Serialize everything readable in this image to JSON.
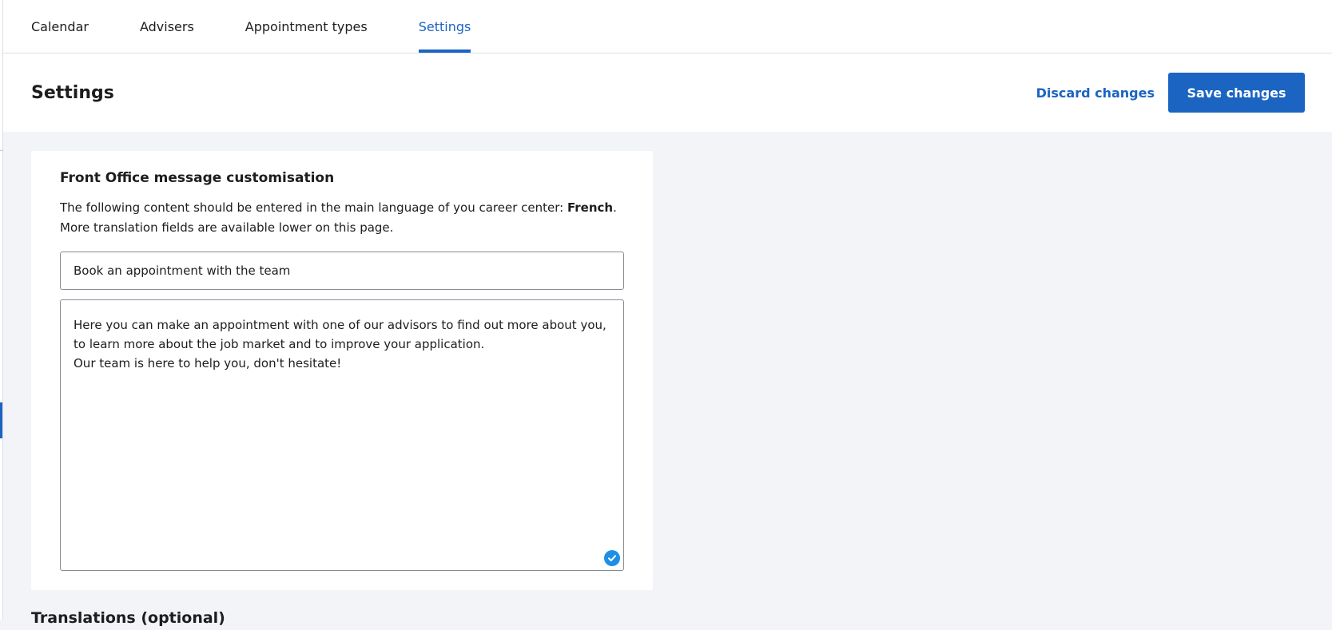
{
  "tabs": [
    {
      "label": "Calendar",
      "active": false
    },
    {
      "label": "Advisers",
      "active": false
    },
    {
      "label": "Appointment types",
      "active": false
    },
    {
      "label": "Settings",
      "active": true
    }
  ],
  "header": {
    "title": "Settings",
    "discard_label": "Discard changes",
    "save_label": "Save changes"
  },
  "card": {
    "title": "Front Office message customisation",
    "desc_prefix": "The following content should be entered in the main language of you career center: ",
    "desc_language": "French",
    "desc_suffix": ".",
    "desc_line2": "More translation fields are available lower on this page.",
    "title_value": "Book an appointment with the team",
    "message_value": "Here you can make an appointment with one of our advisors to find out more about you, to learn more about the job market and to improve your application.\nOur team is here to help you, don't hesitate!",
    "check_icon": "check-circle-icon"
  },
  "translations": {
    "heading": "Translations (optional)"
  },
  "colors": {
    "accent": "#1b64c2",
    "background": "#f3f4f8",
    "check": "#1d8fe6"
  }
}
